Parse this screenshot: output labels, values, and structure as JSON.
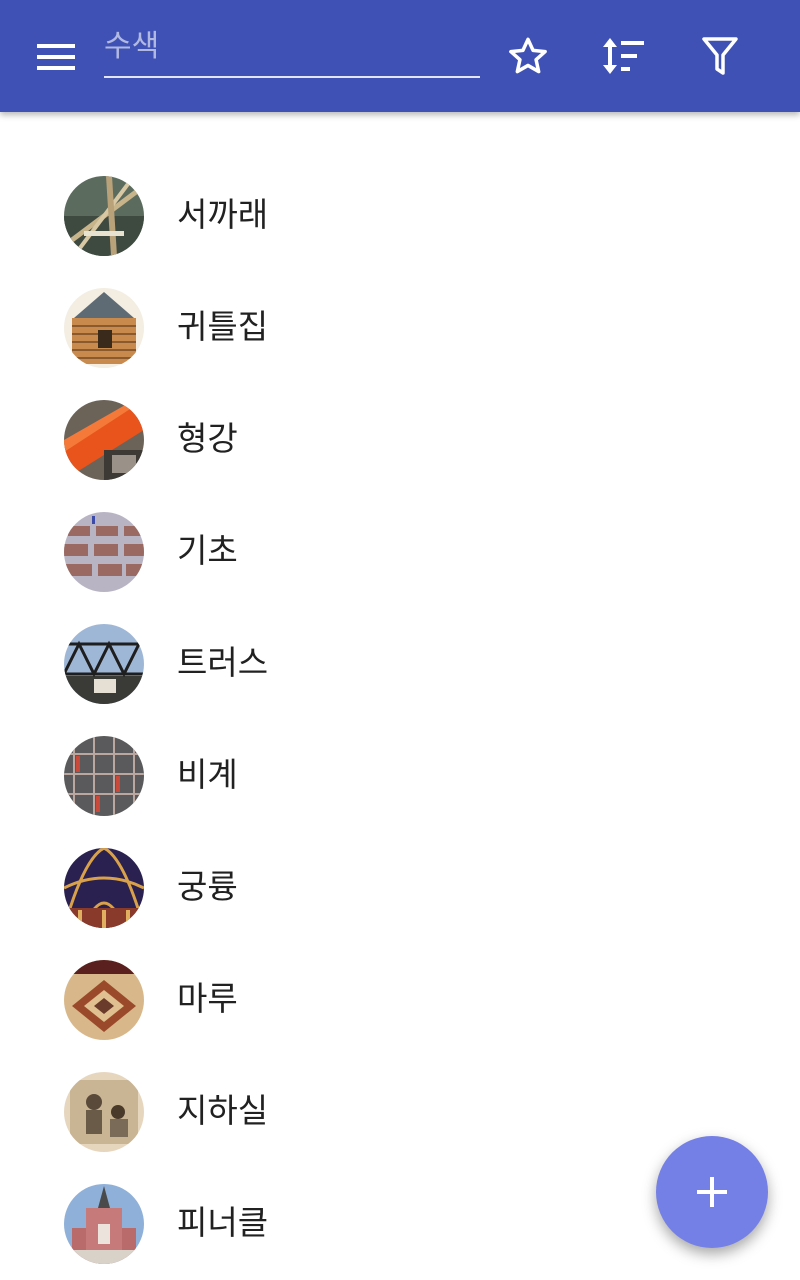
{
  "toolbar": {
    "search_placeholder": "수색",
    "icons": [
      "menu-icon",
      "star-icon",
      "sort-icon",
      "filter-icon"
    ],
    "background_color": "#3f51b5"
  },
  "list": {
    "items": [
      {
        "label": "서까래",
        "thumbnail": "rafters-photo"
      },
      {
        "label": "귀틀집",
        "thumbnail": "log-cabin-photo"
      },
      {
        "label": "형강",
        "thumbnail": "steel-beam-photo"
      },
      {
        "label": "기초",
        "thumbnail": "foundation-photo"
      },
      {
        "label": "트러스",
        "thumbnail": "truss-bridge-photo"
      },
      {
        "label": "비계",
        "thumbnail": "scaffolding-photo"
      },
      {
        "label": "궁륭",
        "thumbnail": "vault-ceiling-photo"
      },
      {
        "label": "마루",
        "thumbnail": "floor-pattern-photo"
      },
      {
        "label": "지하실",
        "thumbnail": "basement-illustration"
      },
      {
        "label": "피너클",
        "thumbnail": "pinnacle-building-photo"
      }
    ]
  },
  "fab": {
    "icon": "plus-icon",
    "color": "#7580e6"
  }
}
